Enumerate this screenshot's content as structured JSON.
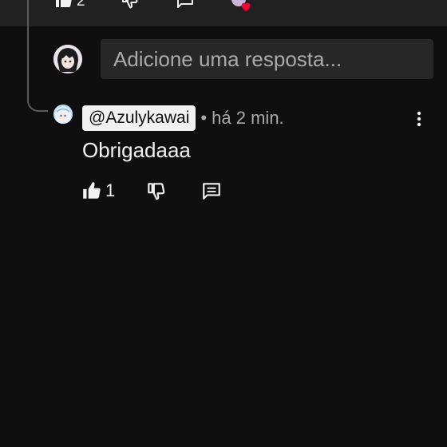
{
  "previous_comment": {
    "like_count": "2"
  },
  "reply_box": {
    "placeholder": "Adicione uma resposta..."
  },
  "comment": {
    "author": "@Azulykawai",
    "meta": "• há 2 min.",
    "text": "Obrigadaaa",
    "like_count": "1"
  },
  "icons": {
    "like": "thumbs-up-icon",
    "dislike": "thumbs-down-icon",
    "reply": "comment-icon",
    "menu": "more-vertical-icon",
    "heart": "heart-icon"
  },
  "colors": {
    "background": "#0f0f0f",
    "input_background": "#272727",
    "text": "#f1f1f1",
    "secondary_text": "#aaaaaa",
    "heart": "#ff0033"
  }
}
